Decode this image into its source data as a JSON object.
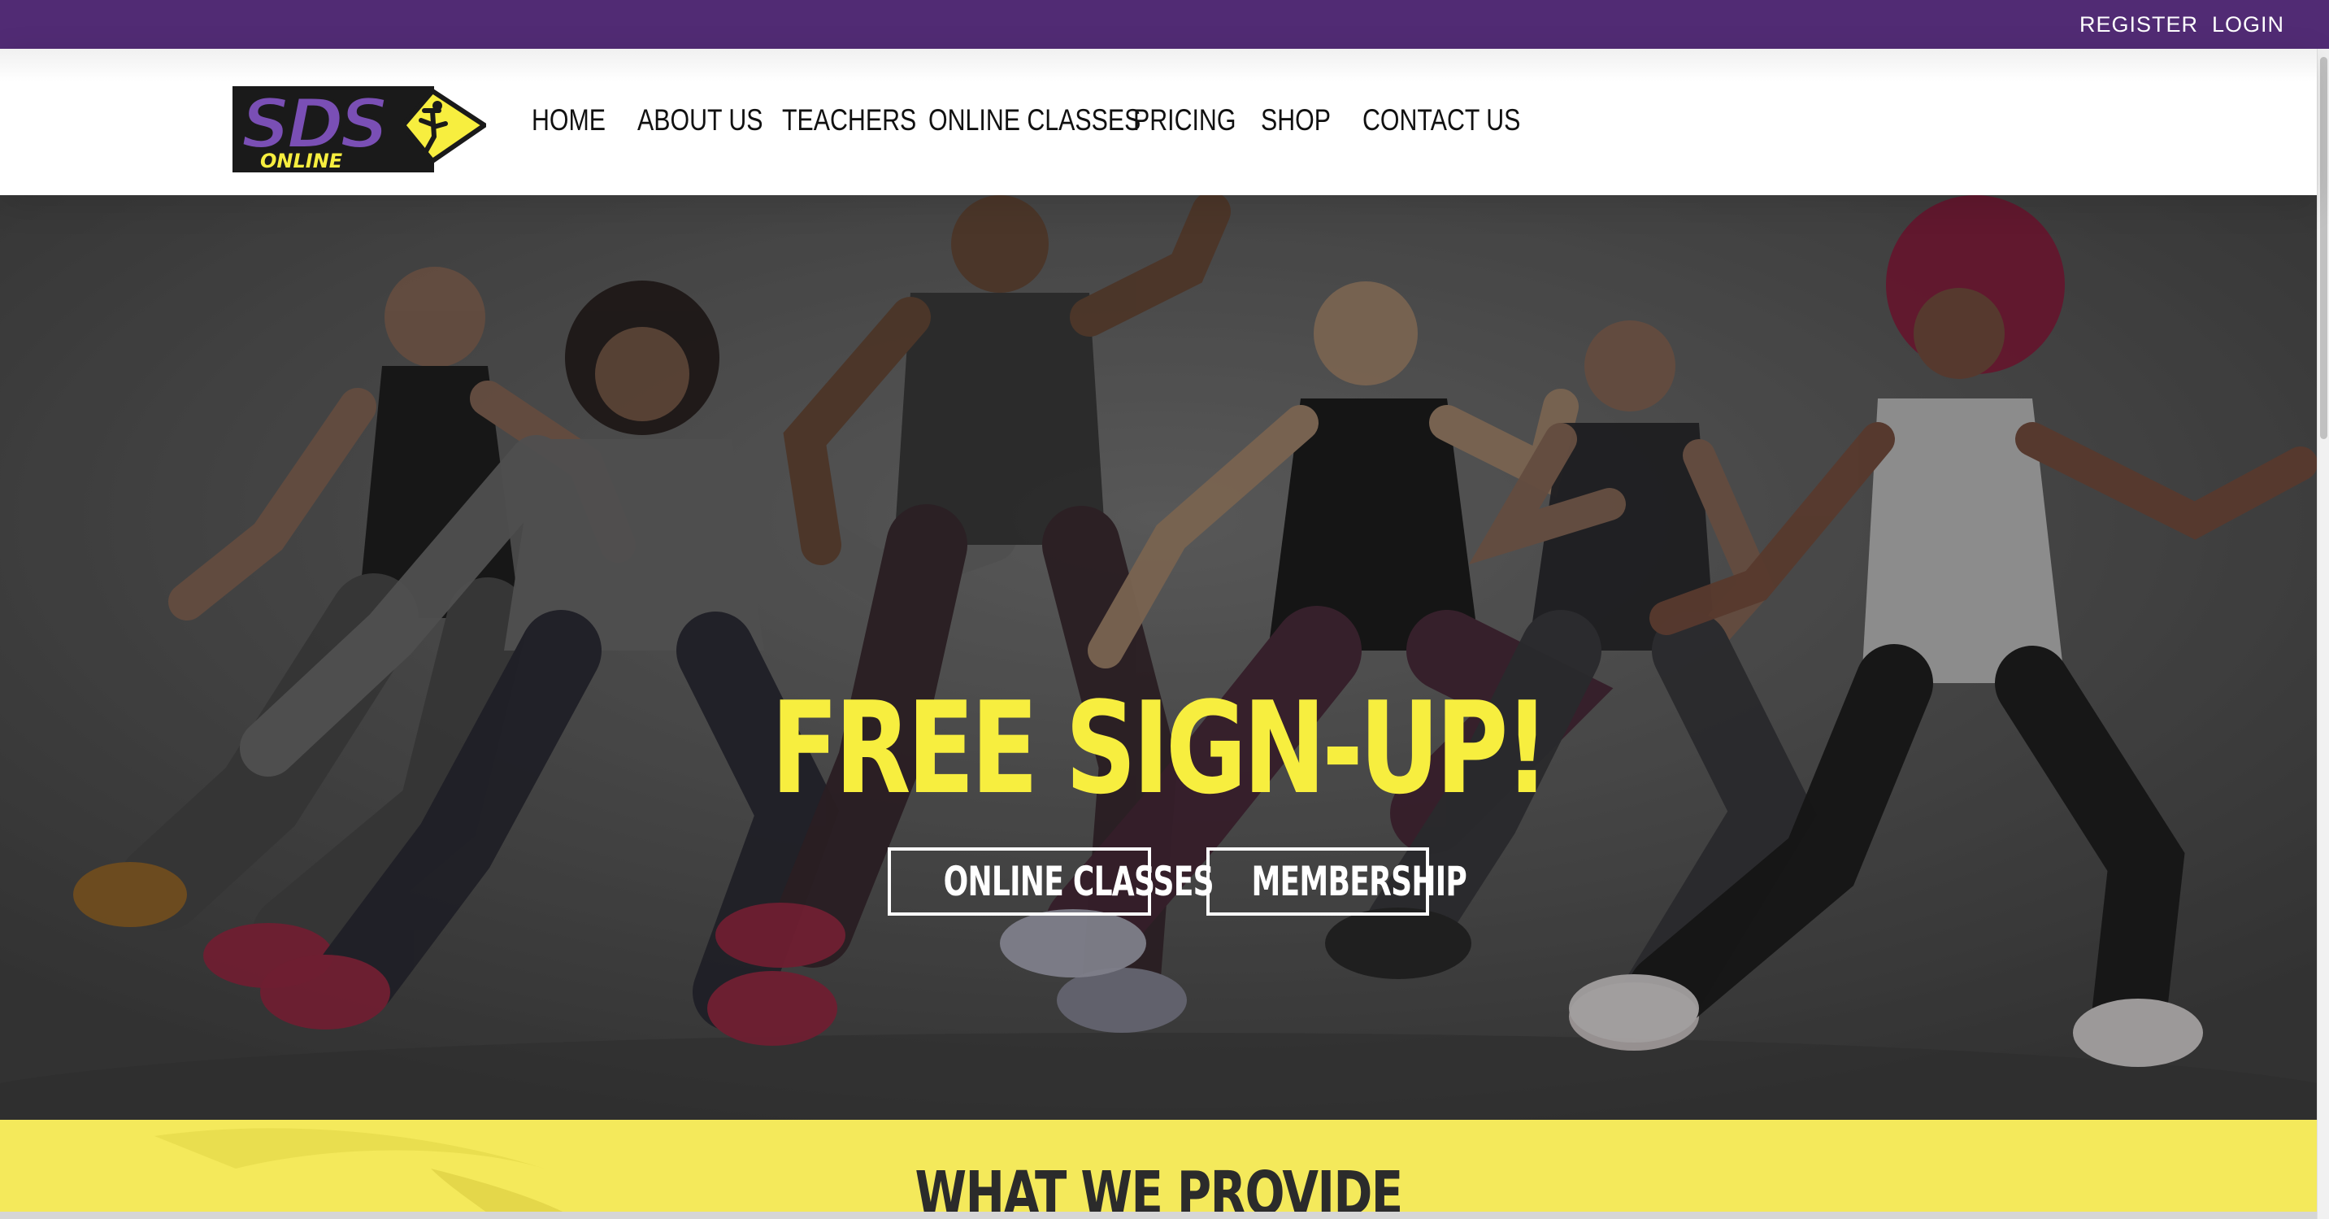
{
  "topbar": {
    "register": "REGISTER",
    "login": "LOGIN",
    "background": "#512b74"
  },
  "logo": {
    "text": "SDS",
    "subtext": "ONLINE",
    "colors": {
      "purple": "#6b3fa0",
      "yellow": "#f7ee3f",
      "dark": "#1a1a1a"
    }
  },
  "nav": {
    "items": [
      {
        "label": "HOME"
      },
      {
        "label": "ABOUT US"
      },
      {
        "label": "TEACHERS"
      },
      {
        "label": "ONLINE CLASSES"
      },
      {
        "label": "PRICING"
      },
      {
        "label": "SHOP"
      },
      {
        "label": "CONTACT US"
      }
    ]
  },
  "hero": {
    "title": "FREE SIGN-UP!",
    "buttons": {
      "classes": "ONLINE CLASSES",
      "membership": "MEMBERSHIP"
    },
    "accent": "#f7ee3f"
  },
  "provide": {
    "title": "WHAT WE PROVIDE",
    "background": "#f4e95b"
  }
}
